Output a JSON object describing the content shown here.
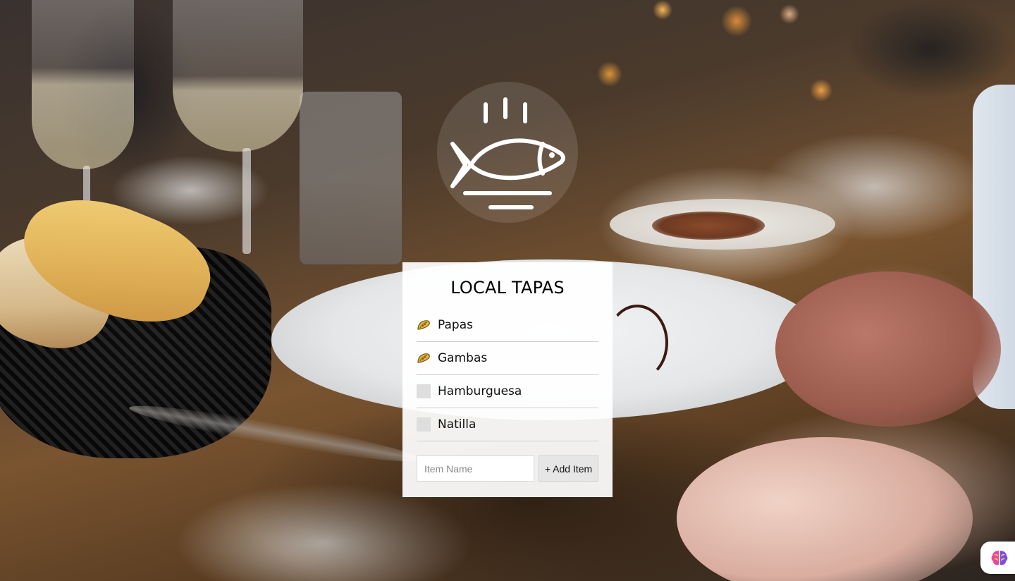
{
  "app": {
    "title": "LOCAL TAPAS"
  },
  "logo": {
    "icon": "fish-dish-icon",
    "color": "#ffffff"
  },
  "list": {
    "items": [
      {
        "label": "Papas",
        "done": true,
        "icon": "taco-icon"
      },
      {
        "label": "Gambas",
        "done": true,
        "icon": "taco-icon"
      },
      {
        "label": "Hamburguesa",
        "done": false,
        "icon": "checkbox-icon"
      },
      {
        "label": "Natilla",
        "done": false,
        "icon": "checkbox-icon"
      }
    ]
  },
  "add_form": {
    "input_value": "",
    "input_placeholder": "Item Name",
    "button_label": "+ Add Item"
  },
  "widget": {
    "icon": "brain-icon"
  },
  "colors": {
    "card_background": "#ffffff",
    "checkbox_empty": "#dedede",
    "button_background": "#e6e6e6",
    "divider": "#cfcfcf"
  }
}
